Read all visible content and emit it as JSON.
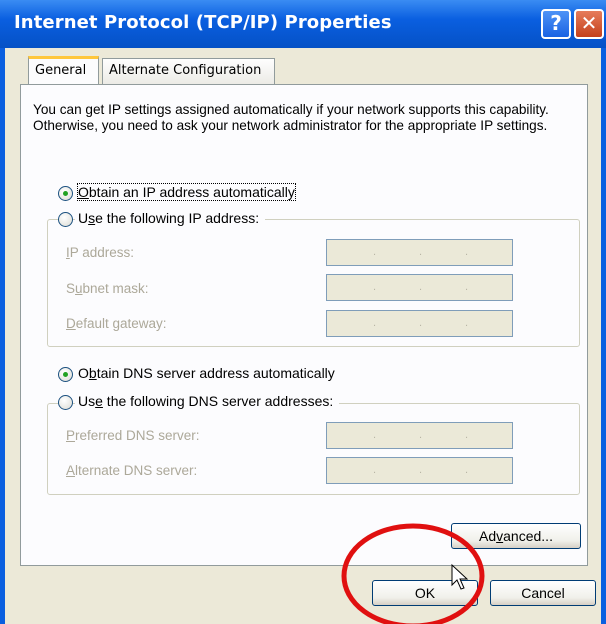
{
  "window": {
    "title": "Internet Protocol (TCP/IP) Properties",
    "help_label": "?",
    "close_label": "✕"
  },
  "tabs": [
    {
      "label": "General",
      "selected": true
    },
    {
      "label": "Alternate Configuration",
      "selected": false
    }
  ],
  "description": "You can get IP settings assigned automatically if your network supports this capability. Otherwise, you need to ask your network administrator for the appropriate IP settings.",
  "ip_section": {
    "auto": {
      "pre": "",
      "acc": "O",
      "post": "btain an IP address automatically",
      "checked": true
    },
    "manual": {
      "pre": "U",
      "acc": "s",
      "post": "e the following IP address:",
      "checked": false
    },
    "fields": [
      {
        "pre": "",
        "acc": "I",
        "post": "P address:"
      },
      {
        "pre": "S",
        "acc": "u",
        "post": "bnet mask:"
      },
      {
        "pre": "",
        "acc": "D",
        "post": "efault gateway:"
      }
    ]
  },
  "dns_section": {
    "auto": {
      "pre": "O",
      "acc": "b",
      "post": "tain DNS server address automatically",
      "checked": true
    },
    "manual": {
      "pre": "Us",
      "acc": "e",
      "post": " the following DNS server addresses:",
      "checked": false
    },
    "fields": [
      {
        "pre": "",
        "acc": "P",
        "post": "referred DNS server:"
      },
      {
        "pre": "",
        "acc": "A",
        "post": "lternate DNS server:"
      }
    ]
  },
  "ip_dot": ".",
  "buttons": {
    "advanced": {
      "pre": "Ad",
      "acc": "v",
      "post": "anced..."
    },
    "ok": "OK",
    "cancel": "Cancel"
  },
  "annotation_color": "#e01010",
  "colors": {
    "title_bar": "#0a5fe0",
    "dialog_bg": "#ece9d8",
    "radio_dot": "#21a121"
  }
}
